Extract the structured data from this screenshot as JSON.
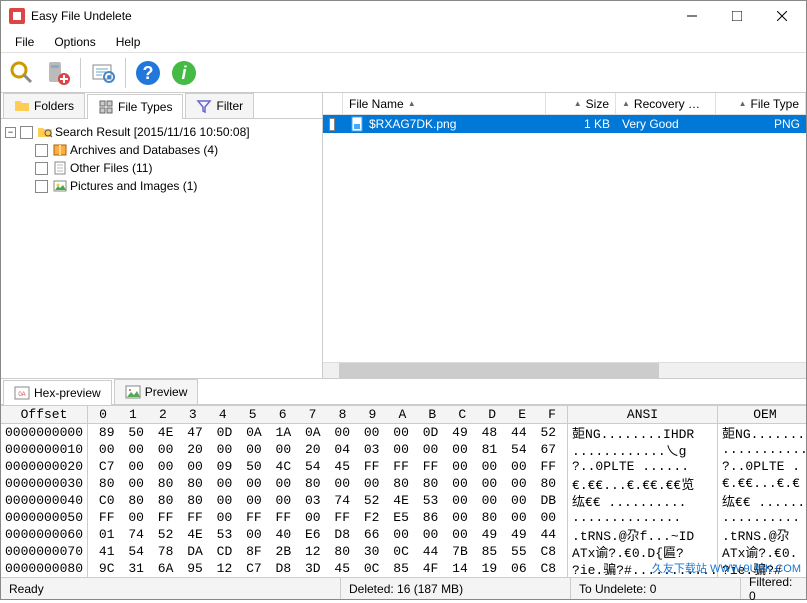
{
  "window": {
    "title": "Easy File Undelete"
  },
  "menu": {
    "file": "File",
    "options": "Options",
    "help": "Help"
  },
  "tabs_left": {
    "folders": "Folders",
    "filetypes": "File Types",
    "filter": "Filter"
  },
  "tree": {
    "root": "Search Result [2015/11/16 10:50:08]",
    "n1": "Archives and Databases (4)",
    "n2": "Other Files (11)",
    "n3": "Pictures and Images (1)"
  },
  "list": {
    "headers": {
      "name": "File Name",
      "size": "Size",
      "recovery": "Recovery …",
      "type": "File Type"
    },
    "row": {
      "name": "$RXAG7DK.png",
      "size": "1 KB",
      "recovery": "Very Good",
      "type": "PNG"
    }
  },
  "hex_tabs": {
    "hex": "Hex-preview",
    "preview": "Preview"
  },
  "hex": {
    "offset_label": "Offset",
    "ansi_label": "ANSI",
    "oem_label": "OEM",
    "byte_headers": [
      "0",
      "1",
      "2",
      "3",
      "4",
      "5",
      "6",
      "7",
      "8",
      "9",
      "A",
      "B",
      "C",
      "D",
      "E",
      "F"
    ],
    "rows": [
      {
        "offset": "0000000000",
        "bytes": [
          "89",
          "50",
          "4E",
          "47",
          "0D",
          "0A",
          "1A",
          "0A",
          "00",
          "00",
          "00",
          "0D",
          "49",
          "48",
          "44",
          "52"
        ],
        "ansi": "壾NG........IHDR",
        "oem": "壾NG......."
      },
      {
        "offset": "0000000010",
        "bytes": [
          "00",
          "00",
          "00",
          "20",
          "00",
          "00",
          "00",
          "20",
          "04",
          "03",
          "00",
          "00",
          "00",
          "81",
          "54",
          "67"
        ],
        "ansi": "............乀g",
        "oem": "..........."
      },
      {
        "offset": "0000000020",
        "bytes": [
          "C7",
          "00",
          "00",
          "00",
          "09",
          "50",
          "4C",
          "54",
          "45",
          "FF",
          "FF",
          "FF",
          "00",
          "00",
          "00",
          "FF"
        ],
        "ansi": "?..0PLTE  ......",
        "oem": "?..0PLTE  ."
      },
      {
        "offset": "0000000030",
        "bytes": [
          "80",
          "00",
          "80",
          "80",
          "00",
          "00",
          "00",
          "80",
          "00",
          "00",
          "80",
          "80",
          "00",
          "00",
          "00",
          "80"
        ],
        "ansi": "€.€€...€.€€.€€览",
        "oem": "€.€€...€.€"
      },
      {
        "offset": "0000000040",
        "bytes": [
          "C0",
          "80",
          "80",
          "80",
          "00",
          "00",
          "00",
          "03",
          "74",
          "52",
          "4E",
          "53",
          "00",
          "00",
          "00",
          "DB"
        ],
        "ansi": "纮€€ ..........",
        "oem": "纮€€ ......"
      },
      {
        "offset": "0000000050",
        "bytes": [
          "FF",
          "00",
          "FF",
          "FF",
          "00",
          "FF",
          "FF",
          "00",
          "FF",
          "F2",
          "E5",
          "86",
          "00",
          "80",
          "00",
          "00"
        ],
        "ansi": "..............",
        "oem": ".........."
      },
      {
        "offset": "0000000060",
        "bytes": [
          "01",
          "74",
          "52",
          "4E",
          "53",
          "00",
          "40",
          "E6",
          "D8",
          "66",
          "00",
          "00",
          "00",
          "49",
          "49",
          "44"
        ],
        "ansi": ".tRNS.@尕f...~ID",
        "oem": ".tRNS.@尕"
      },
      {
        "offset": "0000000070",
        "bytes": [
          "41",
          "54",
          "78",
          "DA",
          "CD",
          "8F",
          "2B",
          "12",
          "80",
          "30",
          "0C",
          "44",
          "7B",
          "85",
          "55",
          "C8"
        ],
        "ansi": "ATx谕?.€0.D{匾?",
        "oem": "ATx谕?.€0."
      },
      {
        "offset": "0000000080",
        "bytes": [
          "9C",
          "31",
          "6A",
          "95",
          "12",
          "C7",
          "D8",
          "3D",
          "45",
          "0C",
          "85",
          "4F",
          "14",
          "19",
          "06",
          "C8"
        ],
        "ansi": "?ie.骗?#............",
        "oem": "?ie.骗?#"
      }
    ]
  },
  "status": {
    "ready": "Ready",
    "deleted": "Deleted: 16 (187 MB)",
    "undelete": "To Undelete: 0",
    "filtered": "Filtered: 0"
  },
  "watermark": "久友下载站  WWW.9UPK.COM"
}
